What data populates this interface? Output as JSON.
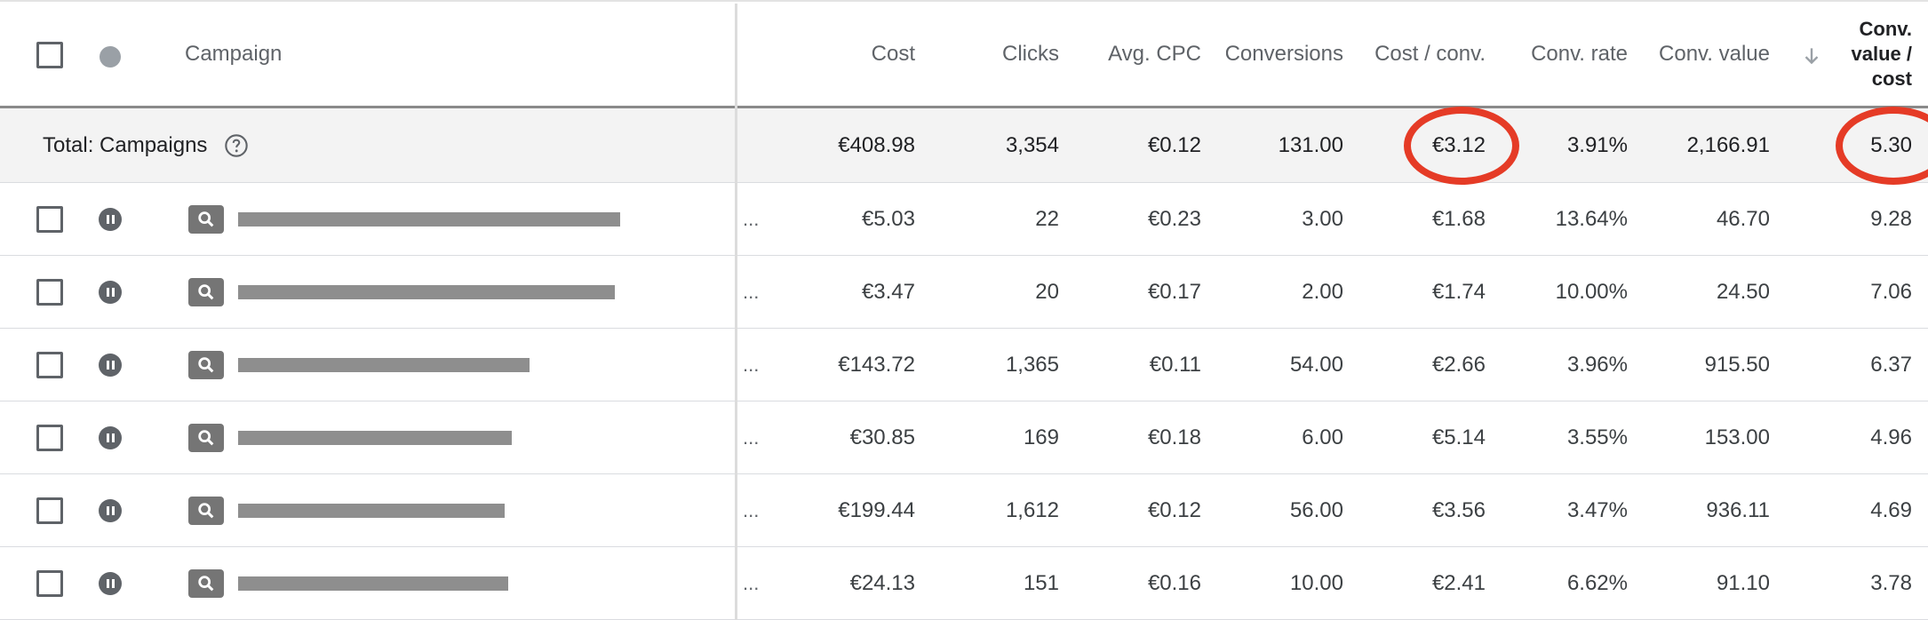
{
  "header": {
    "campaign": "Campaign",
    "cost": "Cost",
    "clicks": "Clicks",
    "avg_cpc": "Avg. CPC",
    "conversions": "Conversions",
    "cost_per_conv": "Cost / conv.",
    "conv_rate": "Conv. rate",
    "conv_value": "Conv. value",
    "conv_value_cost_line1": "Conv.",
    "conv_value_cost_line2": "value /",
    "conv_value_cost_line3": "cost"
  },
  "total": {
    "label": "Total: Campaigns",
    "cost": "€408.98",
    "clicks": "3,354",
    "avg_cpc": "€0.12",
    "conversions": "131.00",
    "cost_per_conv": "€3.12",
    "conv_rate": "3.91%",
    "conv_value": "2,166.91",
    "conv_value_cost": "5.30"
  },
  "rows": [
    {
      "ellipsis": "...",
      "cost": "€5.03",
      "clicks": "22",
      "avg_cpc": "€0.23",
      "conversions": "3.00",
      "cost_per_conv": "€1.68",
      "conv_rate": "13.64%",
      "conv_value": "46.70",
      "conv_value_cost": "9.28"
    },
    {
      "ellipsis": "...",
      "cost": "€3.47",
      "clicks": "20",
      "avg_cpc": "€0.17",
      "conversions": "2.00",
      "cost_per_conv": "€1.74",
      "conv_rate": "10.00%",
      "conv_value": "24.50",
      "conv_value_cost": "7.06"
    },
    {
      "ellipsis": "...",
      "cost": "€143.72",
      "clicks": "1,365",
      "avg_cpc": "€0.11",
      "conversions": "54.00",
      "cost_per_conv": "€2.66",
      "conv_rate": "3.96%",
      "conv_value": "915.50",
      "conv_value_cost": "6.37"
    },
    {
      "ellipsis": "...",
      "cost": "€30.85",
      "clicks": "169",
      "avg_cpc": "€0.18",
      "conversions": "6.00",
      "cost_per_conv": "€5.14",
      "conv_rate": "3.55%",
      "conv_value": "153.00",
      "conv_value_cost": "4.96"
    },
    {
      "ellipsis": "...",
      "cost": "€199.44",
      "clicks": "1,612",
      "avg_cpc": "€0.12",
      "conversions": "56.00",
      "cost_per_conv": "€3.56",
      "conv_rate": "3.47%",
      "conv_value": "936.11",
      "conv_value_cost": "4.69"
    },
    {
      "ellipsis": "...",
      "cost": "€24.13",
      "clicks": "151",
      "avg_cpc": "€0.16",
      "conversions": "10.00",
      "cost_per_conv": "€2.41",
      "conv_rate": "6.62%",
      "conv_value": "91.10",
      "conv_value_cost": "3.78"
    }
  ],
  "colors": {
    "accent": "#4a7fd1",
    "highlight": "#e53b26"
  },
  "icons": {
    "help": "help-circle-icon",
    "sort": "arrow-down-icon",
    "status": "pause-icon",
    "type": "search-icon"
  }
}
